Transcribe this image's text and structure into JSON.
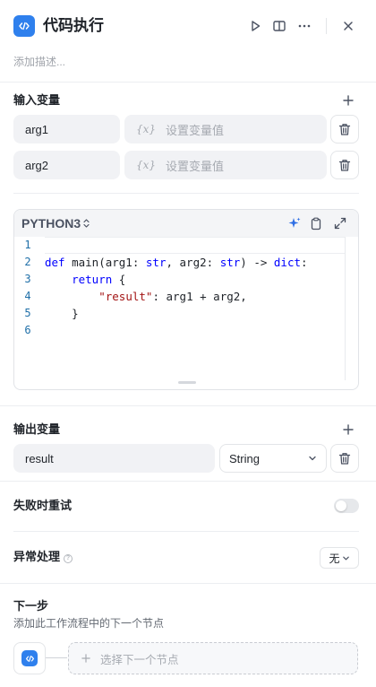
{
  "header": {
    "title": "代码执行",
    "description_placeholder": "添加描述..."
  },
  "inputs": {
    "title": "输入变量",
    "rows": [
      {
        "name": "arg1",
        "value_placeholder": "设置变量值"
      },
      {
        "name": "arg2",
        "value_placeholder": "设置变量值"
      }
    ],
    "value_prefix": "{x}"
  },
  "code": {
    "language": "PYTHON3",
    "line_numbers": [
      "1",
      "2",
      "3",
      "4",
      "5",
      "6"
    ],
    "lines": [
      "",
      "def main(arg1: str, arg2: str) -> dict:",
      "    return {",
      "        \"result\": arg1 + arg2,",
      "    }",
      ""
    ]
  },
  "outputs": {
    "title": "输出变量",
    "rows": [
      {
        "name": "result",
        "type": "String"
      }
    ]
  },
  "retry": {
    "label": "失败时重试",
    "enabled": false
  },
  "error_handling": {
    "label": "异常处理",
    "help_glyph": "?",
    "value": "无"
  },
  "next_step": {
    "title": "下一步",
    "subtitle": "添加此工作流程中的下一个节点",
    "select_label": "选择下一个节点"
  },
  "colors": {
    "accent": "#2f80ed",
    "keyword": "#0000ff",
    "string": "#a31515"
  }
}
